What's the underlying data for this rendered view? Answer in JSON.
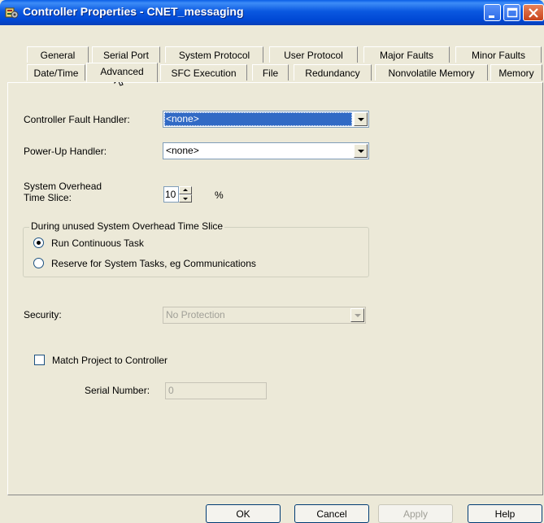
{
  "window": {
    "title": "Controller Properties - CNET_messaging",
    "icon": "controller-properties-icon"
  },
  "tabs_back": [
    "General",
    "Serial Port",
    "System Protocol",
    "User Protocol",
    "Major Faults",
    "Minor Faults"
  ],
  "tabs_front": [
    "Date/Time",
    "Advanced",
    "SFC Execution",
    "File",
    "Redundancy",
    "Nonvolatile Memory",
    "Memory"
  ],
  "active_tab": "Advanced",
  "form": {
    "fault_handler_label": "Controller Fault Handler:",
    "fault_handler_value": "<none>",
    "powerup_label": "Power-Up Handler:",
    "powerup_value": "<none>",
    "overhead_label_line1": "System Overhead",
    "overhead_label_line2": "Time Slice:",
    "overhead_value": "10",
    "overhead_unit": "%",
    "unused_group_title": "During unused System Overhead Time Slice",
    "radio_run": "Run Continuous Task",
    "radio_run_checked": true,
    "radio_reserve": "Reserve for System Tasks, eg Communications",
    "radio_reserve_checked": false,
    "security_label": "Security:",
    "security_value": "No Protection",
    "match_label": "Match Project to Controller",
    "match_checked": false,
    "serial_label": "Serial Number:",
    "serial_value": "0"
  },
  "buttons": {
    "ok": "OK",
    "cancel": "Cancel",
    "apply": "Apply",
    "help": "Help"
  },
  "colors": {
    "titlebar": "#0a58e0",
    "dialog_bg": "#ece9d8",
    "selection": "#316ac5"
  }
}
